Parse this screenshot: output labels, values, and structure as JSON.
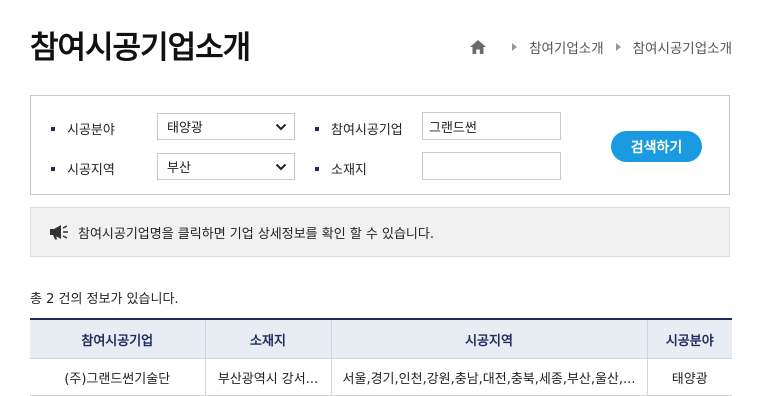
{
  "page": {
    "title": "참여시공기업소개"
  },
  "breadcrumb": {
    "items": [
      "참여기업소개",
      "참여시공기업소개"
    ]
  },
  "search": {
    "field_label": "시공분야",
    "field_value": "태양광",
    "company_label": "참여시공기업",
    "company_value": "그랜드썬",
    "region_label": "시공지역",
    "region_value": "부산",
    "location_label": "소재지",
    "location_value": "",
    "button_label": "검색하기"
  },
  "notice": {
    "text": "참여시공기업명을 클릭하면 기업 상세정보를 확인 할 수 있습니다."
  },
  "results": {
    "count_text": "총 2 건의 정보가 있습니다.",
    "columns": [
      "참여시공기업",
      "소재지",
      "시공지역",
      "시공분야"
    ],
    "rows": [
      [
        "(주)그랜드썬기술단",
        "부산광역시 강서...",
        "서울,경기,인천,강원,충남,대전,충북,세종,부산,울산,...",
        "태양광"
      ]
    ]
  },
  "colors": {
    "accent": "#1a9ae0",
    "navy": "#1d2e5c",
    "header_bg": "#e8edf3",
    "notice_bg": "#f1f1f1"
  }
}
